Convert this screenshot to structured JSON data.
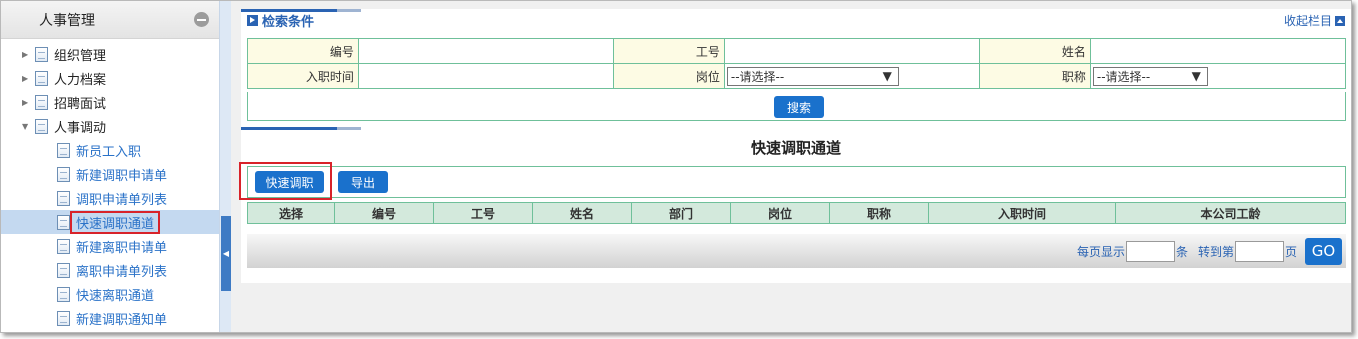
{
  "sidebar": {
    "title": "人事管理",
    "items": [
      {
        "label": "组织管理",
        "expanded": false
      },
      {
        "label": "人力档案",
        "expanded": false
      },
      {
        "label": "招聘面试",
        "expanded": false
      },
      {
        "label": "人事调动",
        "expanded": true
      }
    ],
    "subitems": [
      "新员工入职",
      "新建调职申请单",
      "调职申请单列表",
      "快速调职通道",
      "新建离职申请单",
      "离职申请单列表",
      "快速离职通道",
      "新建调职通知单"
    ],
    "selected": "快速调职通道"
  },
  "search": {
    "title": "检索条件",
    "collapse_label": "收起栏目",
    "fields": {
      "code_label": "编号",
      "code_value": "",
      "empno_label": "工号",
      "empno_value": "",
      "name_label": "姓名",
      "name_value": "",
      "hire_label": "入职时间",
      "hire_value": "",
      "post_label": "岗位",
      "post_value": "--请选择--",
      "title_label": "职称",
      "title_value": "--请选择--"
    },
    "search_button": "搜索"
  },
  "main": {
    "heading": "快速调职通道",
    "quick_button": "快速调职",
    "export_button": "导出",
    "columns": [
      "选择",
      "编号",
      "工号",
      "姓名",
      "部门",
      "岗位",
      "职称",
      "入职时间",
      "本公司工龄"
    ],
    "rows": []
  },
  "pager": {
    "per_page_prefix": "每页显示",
    "per_page_suffix": "条",
    "goto_prefix": "转到第",
    "goto_suffix": "页",
    "per_page_value": "",
    "goto_value": "",
    "go_label": "GO"
  },
  "colors": {
    "accent": "#1a71cc",
    "border": "#6fc09a",
    "highlight": "#d8232a"
  }
}
